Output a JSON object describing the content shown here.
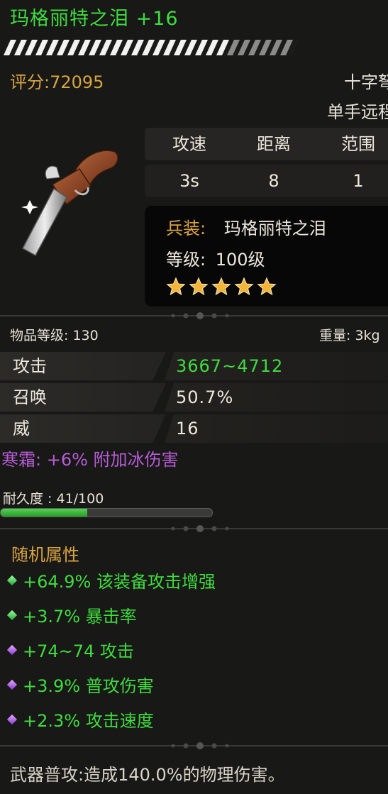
{
  "item": {
    "name": "玛格丽特之泪 +16",
    "score": "评分:72095",
    "weapon_type": "十字弩",
    "weapon_class": "单手远程",
    "name_color": "#3fdc3f"
  },
  "stats": {
    "headers": [
      "攻速",
      "距离",
      "范围"
    ],
    "values": [
      "3s",
      "8",
      "1"
    ]
  },
  "info": {
    "equip_label": "兵装:",
    "equip_value": "玛格丽特之泪",
    "level_label": "等级:",
    "level_value": "100级",
    "stars": 5
  },
  "meta": {
    "item_level": "物品等级: 130",
    "weight": "重量: 3kg"
  },
  "attributes": [
    {
      "label": "攻击",
      "value": "3667~4712",
      "color": "#3fdc3f"
    },
    {
      "label": "召唤",
      "value": "50.7%",
      "color": "#ece8de"
    },
    {
      "label": "威",
      "value": "16",
      "color": "#ece8de"
    }
  ],
  "frost_bonus": "寒霜: +6% 附加冰伤害",
  "durability": {
    "label": "耐久度 : 41/100",
    "current": 41,
    "max": 100
  },
  "random_attrs": {
    "title": "随机属性",
    "items": [
      {
        "text": "+64.9% 该装备攻击增强",
        "gem": "green-gem-icon"
      },
      {
        "text": "+3.7% 暴击率",
        "gem": "green-gem-icon"
      },
      {
        "text": "+74~74 攻击",
        "gem": "purple-gem-icon"
      },
      {
        "text": "+3.9% 普攻伤害",
        "gem": "purple-gem-icon"
      },
      {
        "text": "+2.3% 攻击速度",
        "gem": "purple-gem-icon"
      }
    ]
  },
  "footer": "武器普攻:造成140.0%的物理伤害。"
}
